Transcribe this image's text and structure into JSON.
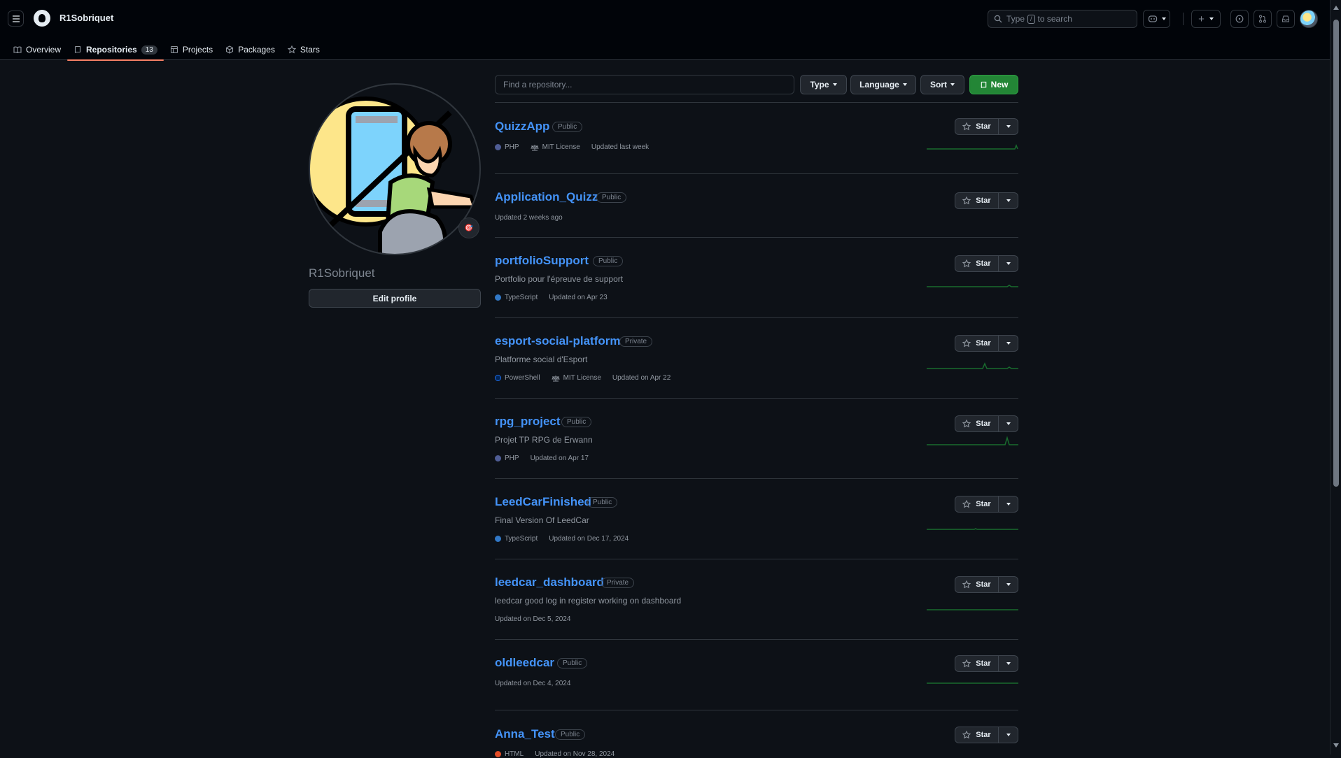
{
  "header": {
    "username": "R1Sobriquet",
    "search_prefix": "Type",
    "search_key": "/",
    "search_suffix": "to search",
    "plus_label": "+"
  },
  "tabs": [
    {
      "label": "Overview",
      "icon": "book-icon"
    },
    {
      "label": "Repositories",
      "icon": "repo-icon",
      "count": "13"
    },
    {
      "label": "Projects",
      "icon": "table-icon"
    },
    {
      "label": "Packages",
      "icon": "package-icon"
    },
    {
      "label": "Stars",
      "icon": "star-icon"
    }
  ],
  "profile": {
    "name": "R1Sobriquet",
    "edit_label": "Edit profile",
    "status_emoji": "🎯"
  },
  "filters": {
    "find_placeholder": "Find a repository...",
    "type_label": "Type",
    "language_label": "Language",
    "sort_label": "Sort",
    "new_label": "New"
  },
  "star_label": "Star",
  "colors": {
    "PHP": "#4F5D95",
    "TypeScript": "#3178c6",
    "PowerShell": "#012456",
    "HTML": "#e34c26",
    "accent": "#4493f8",
    "new_button": "#238636",
    "active_tab": "#f78166"
  },
  "repos": [
    {
      "name": "QuizzApp",
      "visibility": "Public",
      "description": "",
      "language": "PHP",
      "license": "MIT License",
      "updated": "Updated last week"
    },
    {
      "name": "Application_Quizz",
      "visibility": "Public",
      "description": "",
      "language": "",
      "license": "",
      "updated": "Updated 2 weeks ago"
    },
    {
      "name": "portfolioSupport",
      "visibility": "Public",
      "description": "Portfolio pour l'épreuve de support",
      "language": "TypeScript",
      "license": "",
      "updated": "Updated on Apr 23"
    },
    {
      "name": "esport-social-platform",
      "visibility": "Private",
      "description": "Platforme social d'Esport",
      "language": "PowerShell",
      "license": "MIT License",
      "updated": "Updated on Apr 22"
    },
    {
      "name": "rpg_project",
      "visibility": "Public",
      "description": "Projet TP RPG de Erwann",
      "language": "PHP",
      "license": "",
      "updated": "Updated on Apr 17"
    },
    {
      "name": "LeedCarFinished",
      "visibility": "Public",
      "description": "Final Version Of LeedCar",
      "language": "TypeScript",
      "license": "",
      "updated": "Updated on Dec 17, 2024"
    },
    {
      "name": "leedcar_dashboard",
      "visibility": "Private",
      "description": "leedcar good log in register working on dashboard",
      "language": "",
      "license": "",
      "updated": "Updated on Dec 5, 2024"
    },
    {
      "name": "oldleedcar",
      "visibility": "Public",
      "description": "",
      "language": "",
      "license": "",
      "updated": "Updated on Dec 4, 2024"
    },
    {
      "name": "Anna_Test",
      "visibility": "Public",
      "description": "",
      "language": "HTML",
      "license": "",
      "updated": "Updated on Nov 28, 2024"
    }
  ]
}
